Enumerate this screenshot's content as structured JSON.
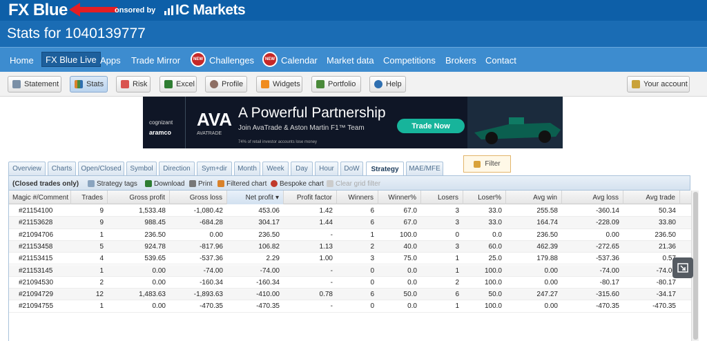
{
  "brand": {
    "logo": "FX Blue",
    "sponsored": "onsored by",
    "sponsor": "IC Markets"
  },
  "page_title": "Stats for 1040139777",
  "nav": [
    {
      "label": "Home",
      "active": false
    },
    {
      "label": "FX Blue Live",
      "active": true
    },
    {
      "label": "Apps",
      "active": false
    },
    {
      "label": "Trade Mirror",
      "active": false
    },
    {
      "label": "Challenges",
      "active": false,
      "badge": "NEW"
    },
    {
      "label": "Calendar",
      "active": false,
      "badge": "NEW"
    },
    {
      "label": "Market data",
      "active": false
    },
    {
      "label": "Competitions",
      "active": false
    },
    {
      "label": "Brokers",
      "active": false
    },
    {
      "label": "Contact",
      "active": false
    }
  ],
  "toolbar": [
    {
      "label": "Statement",
      "icon": "document-icon"
    },
    {
      "label": "Stats",
      "icon": "bar-chart-icon",
      "selected": true
    },
    {
      "label": "Risk",
      "icon": "risk-icon"
    },
    {
      "label": "Excel",
      "icon": "excel-icon"
    },
    {
      "label": "Profile",
      "icon": "profile-icon"
    },
    {
      "label": "Widgets",
      "icon": "rss-icon"
    },
    {
      "label": "Portfolio",
      "icon": "portfolio-icon"
    },
    {
      "label": "Help",
      "icon": "info-icon"
    }
  ],
  "account_button": "Your account",
  "banner": {
    "cognizant": "cognizant",
    "aramco": "aramco",
    "ava": "AVA",
    "avatrade": "AVATRADE",
    "headline": "A Powerful Partnership",
    "subline": "Join AvaTrade & Aston Martin F1™ Team",
    "cta": "Trade Now",
    "disclaimer": "74% of retail investor accounts lose money"
  },
  "tabs": [
    {
      "label": "Overview"
    },
    {
      "label": "Charts"
    },
    {
      "label": "Open/Closed"
    },
    {
      "label": "Symbol"
    },
    {
      "label": "Direction"
    },
    {
      "label": "Sym+dir"
    },
    {
      "label": "Month"
    },
    {
      "label": "Week"
    },
    {
      "label": "Day"
    },
    {
      "label": "Hour"
    },
    {
      "label": "DoW"
    },
    {
      "label": "Strategy",
      "selected": true
    },
    {
      "label": "MAE/MFE"
    }
  ],
  "filter_label": "Filter",
  "subtoolbar": {
    "closed_only": "(Closed trades only)",
    "items": [
      {
        "label": "Strategy tags",
        "icon": "tag-icon"
      },
      {
        "label": "Download",
        "icon": "download-icon"
      },
      {
        "label": "Print",
        "icon": "print-icon"
      },
      {
        "label": "Filtered chart",
        "icon": "chart-icon"
      },
      {
        "label": "Bespoke chart",
        "icon": "pie-icon"
      },
      {
        "label": "Clear grid filter",
        "icon": "clear-filter-icon",
        "disabled": true
      }
    ]
  },
  "columns": [
    "Magic #/Comment",
    "Trades",
    "Gross profit",
    "Gross loss",
    "Net profit ▾",
    "Profit factor",
    "Winners",
    "Winner%",
    "Losers",
    "Loser%",
    "Avg win",
    "Avg loss",
    "Avg trade"
  ],
  "rows": [
    [
      "#21154100",
      "9",
      "1,533.48",
      "-1,080.42",
      "453.06",
      "1.42",
      "6",
      "67.0",
      "3",
      "33.0",
      "255.58",
      "-360.14",
      "50.34"
    ],
    [
      "#21153628",
      "9",
      "988.45",
      "-684.28",
      "304.17",
      "1.44",
      "6",
      "67.0",
      "3",
      "33.0",
      "164.74",
      "-228.09",
      "33.80"
    ],
    [
      "#21094706",
      "1",
      "236.50",
      "0.00",
      "236.50",
      "-",
      "1",
      "100.0",
      "0",
      "0.0",
      "236.50",
      "0.00",
      "236.50"
    ],
    [
      "#21153458",
      "5",
      "924.78",
      "-817.96",
      "106.82",
      "1.13",
      "2",
      "40.0",
      "3",
      "60.0",
      "462.39",
      "-272.65",
      "21.36"
    ],
    [
      "#21153415",
      "4",
      "539.65",
      "-537.36",
      "2.29",
      "1.00",
      "3",
      "75.0",
      "1",
      "25.0",
      "179.88",
      "-537.36",
      "0.57"
    ],
    [
      "#21153145",
      "1",
      "0.00",
      "-74.00",
      "-74.00",
      "-",
      "0",
      "0.0",
      "1",
      "100.0",
      "0.00",
      "-74.00",
      "-74.00"
    ],
    [
      "#21094530",
      "2",
      "0.00",
      "-160.34",
      "-160.34",
      "-",
      "0",
      "0.0",
      "2",
      "100.0",
      "0.00",
      "-80.17",
      "-80.17"
    ],
    [
      "#21094729",
      "12",
      "1,483.63",
      "-1,893.63",
      "-410.00",
      "0.78",
      "6",
      "50.0",
      "6",
      "50.0",
      "247.27",
      "-315.60",
      "-34.17"
    ],
    [
      "#21094755",
      "1",
      "0.00",
      "-470.35",
      "-470.35",
      "-",
      "0",
      "0.0",
      "1",
      "100.0",
      "0.00",
      "-470.35",
      "-470.35"
    ]
  ],
  "colors": {
    "brand": "#0d5fa8",
    "nav": "#3d8ccf",
    "arrow": "#e31e24",
    "cta": "#17b49b"
  }
}
